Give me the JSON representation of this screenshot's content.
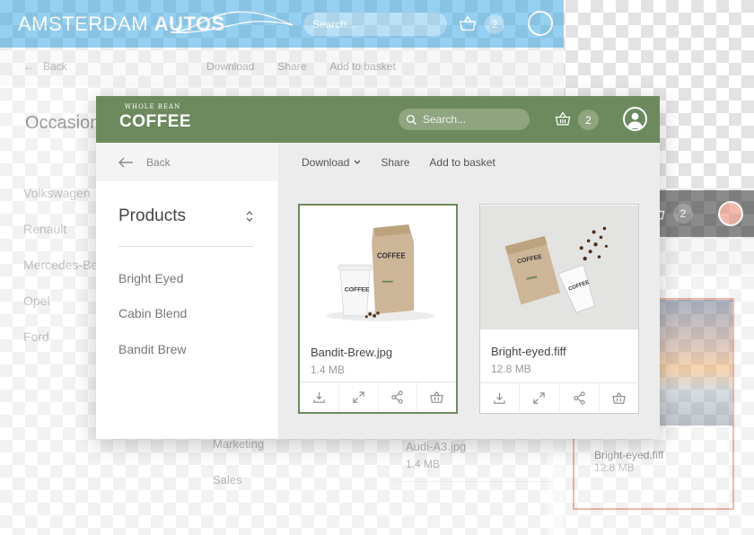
{
  "back_window_autos": {
    "brand_prefix": "AMSTERDAM",
    "brand_suffix": "AUTOS",
    "search_placeholder": "Search...",
    "basket_count": "2",
    "back_label": "Back",
    "toolbar": [
      "Download",
      "Share",
      "Add to basket"
    ],
    "sidebar_title": "Occasion",
    "sidebar_items": [
      "Volkswagen",
      "Renault",
      "Mercedes-Be",
      "Opel",
      "Ford"
    ],
    "bottom_items": [
      "Marketing",
      "Sales"
    ],
    "card": {
      "filename": "Audi-A3.jpg",
      "size": "1.4 MB"
    }
  },
  "back_window_dark": {
    "basket_count": "2",
    "card": {
      "filename": "Bright-eyed.fiff",
      "size": "12.8 MB"
    }
  },
  "coffee": {
    "logo_small": "WHOLE BEAN",
    "logo_big": "COFFEE",
    "search_placeholder": "Search...",
    "basket_count": "2",
    "back_label": "Back",
    "toolbar": {
      "download": "Download",
      "share": "Share",
      "add_to_basket": "Add to basket"
    },
    "sidebar": {
      "title": "Products",
      "items": [
        "Bright Eyed",
        "Cabin Blend",
        "Bandit Brew"
      ]
    },
    "cards": [
      {
        "filename": "Bandit-Brew.jpg",
        "size": "1.4 MB",
        "selected": true
      },
      {
        "filename": "Bright-eyed.fiff",
        "size": "12.8 MB",
        "selected": false
      }
    ],
    "colors": {
      "accent": "#6c8a5e",
      "autos_blue": "#3fa9e6",
      "dark_header": "#2b2b2b",
      "highlight": "#e9826e"
    }
  }
}
